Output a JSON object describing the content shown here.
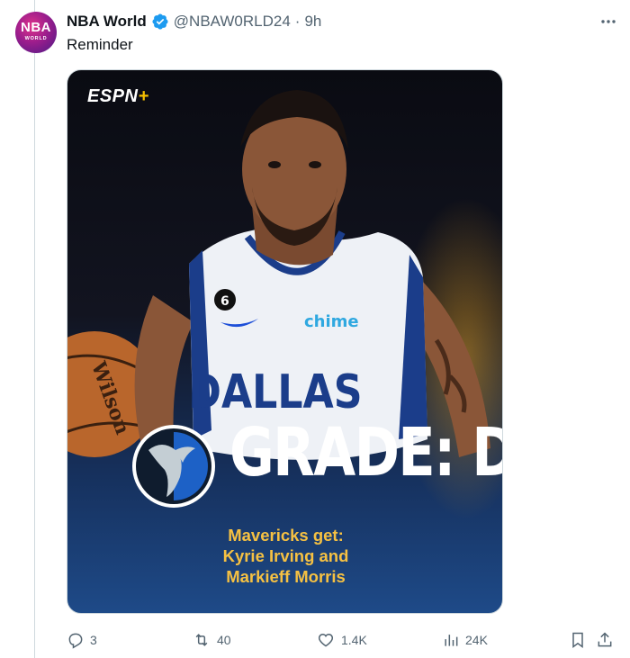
{
  "tweet": {
    "author_name": "NBA World",
    "handle": "@NBAW0RLD24",
    "separator": "·",
    "time": "9h",
    "text": "Reminder",
    "avatar_text": "NBA",
    "avatar_subtext": "WORLD"
  },
  "media": {
    "brand": "ESPN",
    "brand_plus": "+",
    "jersey_text": "DALLAS",
    "jersey_number": "6",
    "sponsor": "chime",
    "ball_text": "Wilson",
    "grade_text": "GRADE: D",
    "caption_lines": [
      "Mavericks get:",
      "Kyrie Irving and",
      "Markieff Morris"
    ]
  },
  "actions": {
    "replies": "3",
    "reposts": "40",
    "likes": "1.4K",
    "views": "24K"
  },
  "colors": {
    "verified": "#1d9bf0",
    "caption": "#f6c142",
    "icon_gray": "#536471"
  }
}
